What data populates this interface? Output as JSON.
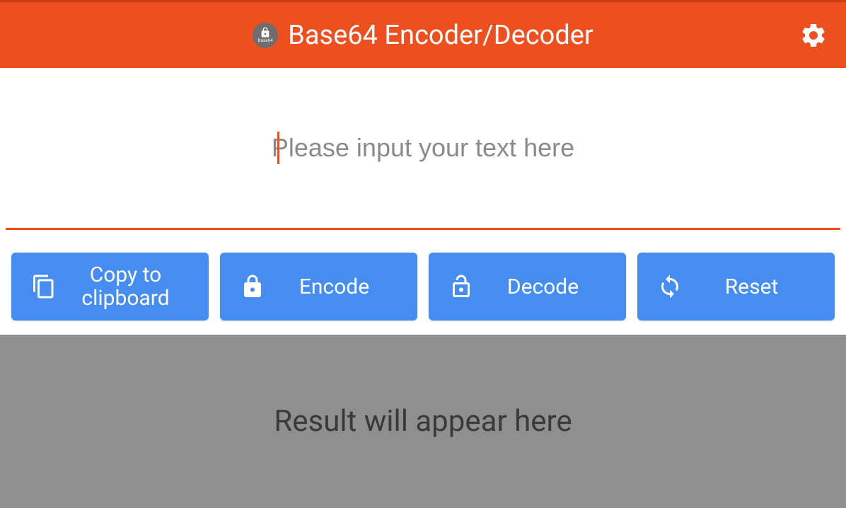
{
  "header": {
    "title": "Base64 Encoder/Decoder",
    "badge_text": "Base64"
  },
  "input": {
    "placeholder": "Please input your text here",
    "value": ""
  },
  "buttons": {
    "copy": "Copy to clipboard",
    "encode": "Encode",
    "decode": "Decode",
    "reset": "Reset"
  },
  "result": {
    "placeholder": "Result will appear here"
  },
  "colors": {
    "brand": "#ed4f1e",
    "button": "#468df2",
    "result_bg": "#8f8f8f"
  }
}
